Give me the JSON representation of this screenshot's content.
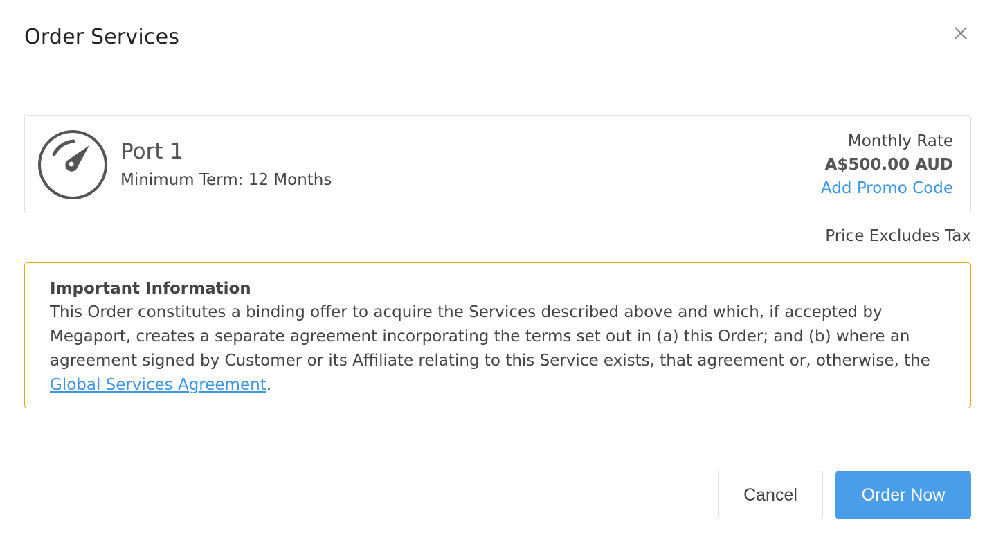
{
  "dialog": {
    "title": "Order Services",
    "close_icon": "close-icon"
  },
  "service": {
    "icon": "speedometer-icon",
    "name": "Port 1",
    "minimum_term": "Minimum Term: 12 Months",
    "rate_label": "Monthly Rate",
    "rate_value": "A$500.00 AUD",
    "promo_link": "Add Promo Code"
  },
  "tax_note": "Price Excludes Tax",
  "important_info": {
    "title": "Important Information",
    "body": "This Order constitutes a binding offer to acquire the Services described above and which, if accepted by Megaport, creates a separate agreement incorporating the terms set out in (a) this Order; and (b) where an agreement signed by Customer or its Affiliate relating to this Service exists, that agreement or, otherwise, the ",
    "link_text": "Global Services Agreement",
    "suffix": "."
  },
  "buttons": {
    "cancel": "Cancel",
    "order": "Order Now"
  },
  "colors": {
    "accent": "#4a9de9",
    "link": "#3d95e7",
    "warning_border": "#e6a817",
    "card_border": "#dcdfe6"
  }
}
